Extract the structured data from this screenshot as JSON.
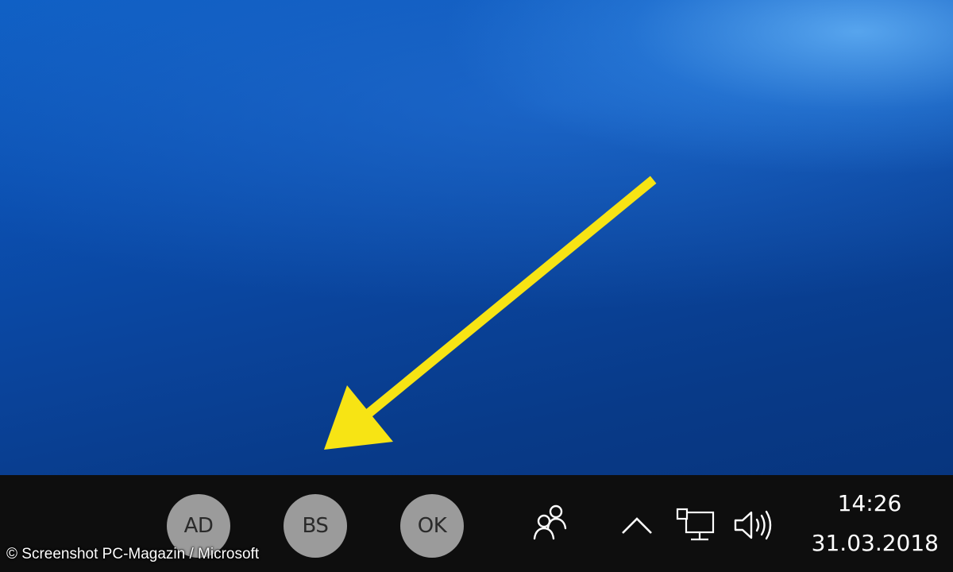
{
  "taskbar": {
    "avatars": [
      {
        "initials": "AD"
      },
      {
        "initials": "BS"
      },
      {
        "initials": "OK"
      }
    ],
    "tray_icons": [
      "people-icon",
      "chevron-up-icon",
      "network-icon",
      "volume-icon"
    ],
    "clock": {
      "time": "14:26",
      "date": "31.03.2018"
    }
  },
  "overlay": {
    "copyright": "© Screenshot PC-Magazin / Microsoft"
  },
  "colors": {
    "desktop_blue": "#0b4fb0",
    "taskbar": "#0e0e0e",
    "avatar_gray": "#9b9b9b",
    "arrow_yellow": "#f7e414"
  }
}
